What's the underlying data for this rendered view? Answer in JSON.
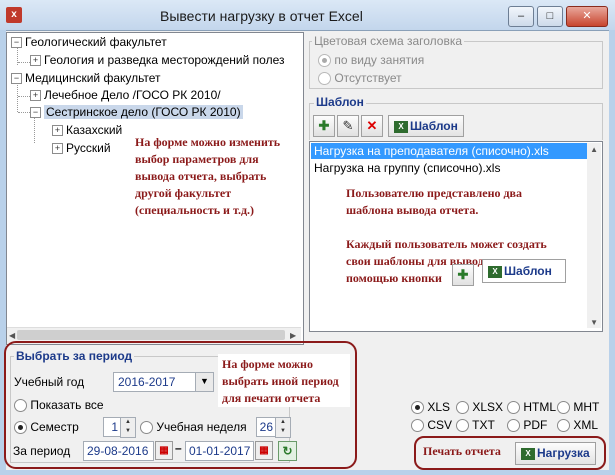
{
  "window": {
    "title": "Вывести нагрузку в отчет Excel",
    "minimize": "–",
    "maximize": "□",
    "close": "✕"
  },
  "tree": {
    "root1": "Геологический факультет",
    "root1_child": "Геология и разведка месторождений полез",
    "root2": "Медицинский факультет",
    "root2_child1": "Лечебное Дело /ГОСО РК 2010/",
    "root2_child2": "Сестринское дело (ГОСО РК 2010)",
    "sub1": "Казахский",
    "sub2": "Русский"
  },
  "annotation_tree": [
    "На форме можно изменить",
    "выбор параметров для",
    "вывода отчета, выбрать",
    "другой факультет",
    "(специальность и т.д.)"
  ],
  "color_scheme": {
    "title": "Цветовая схема заголовка",
    "option1": "по виду занятия",
    "option2": "Отсутствует"
  },
  "template": {
    "title": "Шаблон",
    "button_label": "Шаблон",
    "items": [
      "Нагрузка на преподавателя (списочно).xls",
      "Нагрузка на группу (списочно).xls"
    ]
  },
  "annotation_template": [
    "Пользователю представлено два",
    "шаблона вывода отчета.",
    "",
    "Каждый пользователь может создать",
    "свои шаблоны для вывода данных с",
    "помощью кнопки"
  ],
  "period": {
    "title": "Выбрать за период",
    "year_label": "Учебный год",
    "year_value": "2016-2017",
    "show_all": "Показать все",
    "semester_label": "Семестр",
    "semester_value": "1",
    "week_label": "Учебная неделя",
    "week_value": "26",
    "range_label": "За период",
    "date_from": "29-08-2016",
    "dash": "–",
    "date_to": "01-01-2017"
  },
  "annotation_period": [
    "На форме можно",
    "выбрать иной период",
    "для печати отчета"
  ],
  "formats": [
    "XLS",
    "XLSX",
    "HTML",
    "MHT",
    "CSV",
    "TXT",
    "PDF",
    "XML"
  ],
  "print": {
    "label": "Печать отчета",
    "button": "Нагрузка"
  },
  "colors": {
    "accent_blue": "#1c3a8a",
    "annotation_red": "#8b1a1a",
    "highlight_border": "#8b1a1a",
    "selection": "#3399ff"
  }
}
